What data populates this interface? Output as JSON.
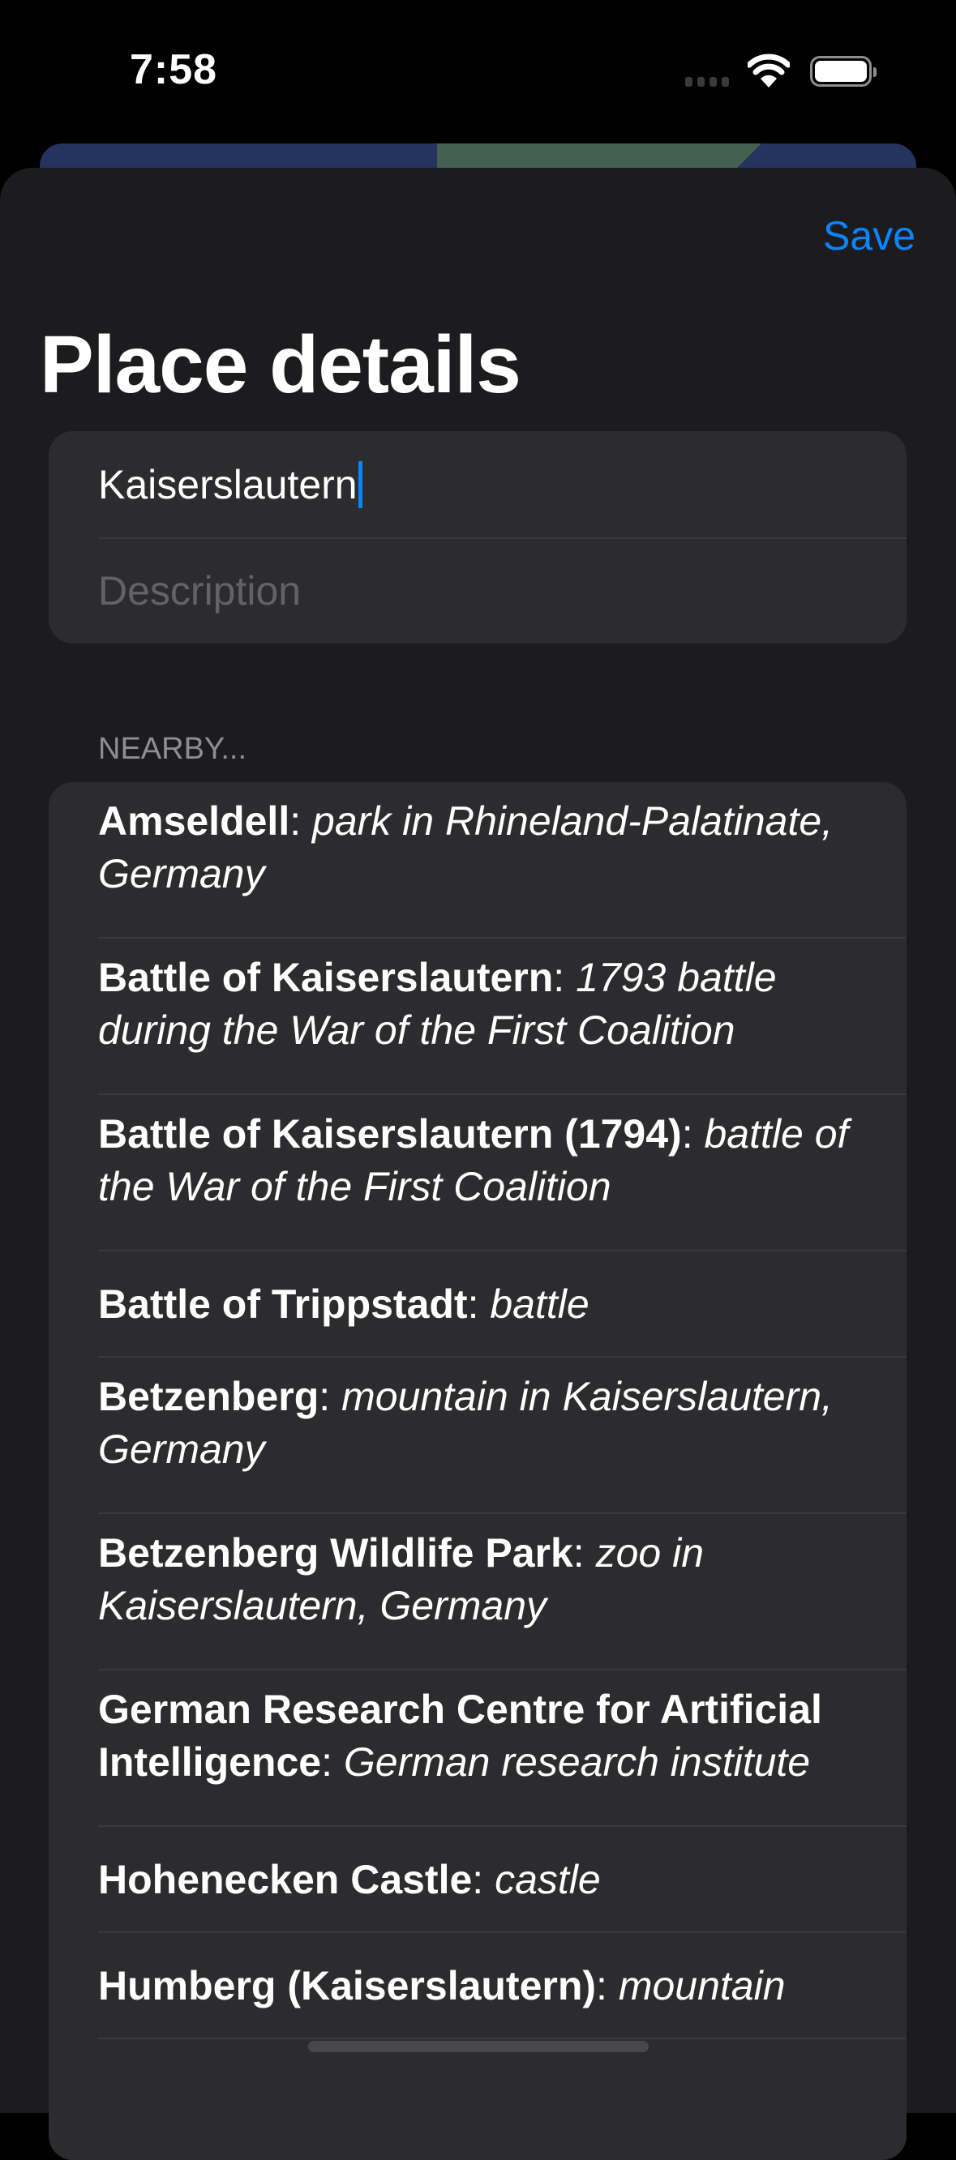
{
  "status_bar": {
    "time": "7:58",
    "icons": [
      "signal-icon",
      "wifi-icon",
      "battery-icon"
    ]
  },
  "nav": {
    "save_label": "Save",
    "title": "Place details"
  },
  "form": {
    "name_value": "Kaiserslautern",
    "description_placeholder": "Description"
  },
  "nearby": {
    "header": "NEARBY...",
    "items": [
      {
        "name": "Amseldell",
        "description": "park in Rhineland-Palatinate, Germany",
        "lines": 2
      },
      {
        "name": "Battle of Kaiserslautern",
        "description": "1793 battle during the War of the First Coalition",
        "lines": 2
      },
      {
        "name": "Battle of Kaiserslautern (1794)",
        "description": "battle of the War of the First Coalition",
        "lines": 2
      },
      {
        "name": "Battle of Trippstadt",
        "description": "battle",
        "lines": 1
      },
      {
        "name": "Betzenberg",
        "description": "mountain in Kaiserslautern, Germany",
        "lines": 2
      },
      {
        "name": "Betzenberg Wildlife Park",
        "description": "zoo in Kaiserslautern, Germany",
        "lines": 2
      },
      {
        "name": "German Research Centre for Artificial Intelligence",
        "description": "German research institute",
        "lines": 2
      },
      {
        "name": "Hohenecken Castle",
        "description": "castle",
        "lines": 1
      },
      {
        "name": "Humberg (Kaiserslautern)",
        "description": "mountain",
        "lines": 1
      }
    ]
  },
  "colors": {
    "accent": "#0a84ff",
    "sheet": "#1c1c1e",
    "card": "#2c2c2e"
  }
}
